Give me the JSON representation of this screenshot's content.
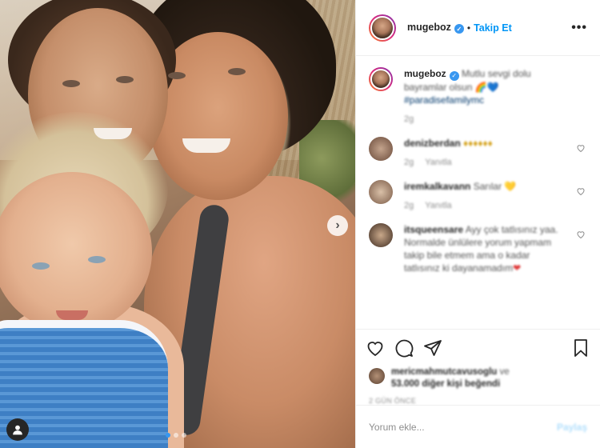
{
  "header": {
    "username": "mugeboz",
    "separator": "•",
    "follow_label": "Takip Et",
    "more_icon": "•••"
  },
  "caption": {
    "username": "mugeboz",
    "text": "Mutlu sevgi dolu bayramlar olsun",
    "hashtag": "#paradisefamilymc",
    "time": "2g"
  },
  "comments": [
    {
      "username": "denizberdan",
      "text": "♦♦♦♦♦♦",
      "time": "2g",
      "reply": "Yanıtla"
    },
    {
      "username": "iremkalkavann",
      "text": "Sarılar",
      "time": "2g",
      "reply": "Yanıtla"
    },
    {
      "username": "itsqueensare",
      "text": "Ayy çok tatlısınız yaa. Normalde ünlülere yorum yapmam takip bile etmem ama o kadar tatlısınız ki dayanamadım",
      "time": "",
      "reply": ""
    }
  ],
  "likes": {
    "first_liker": "mericmahmutcavusoglu",
    "connector": "ve",
    "count_text": "53.000 diğer kişi beğendi"
  },
  "date": "2 GÜN ÖNCE",
  "add_comment": {
    "placeholder": "Yorum ekle...",
    "post_label": "Paylaş"
  },
  "colors": {
    "accent": "#0095f6",
    "verified": "#3897f0",
    "text": "#262626",
    "muted": "#8e8e8e"
  },
  "icons": [
    "chevron-right-icon",
    "user-tag-icon",
    "heart-icon",
    "comment-icon",
    "share-icon",
    "bookmark-icon",
    "verified-icon",
    "more-icon"
  ],
  "carousel": {
    "total_slides": 3,
    "active_slide": 1
  }
}
